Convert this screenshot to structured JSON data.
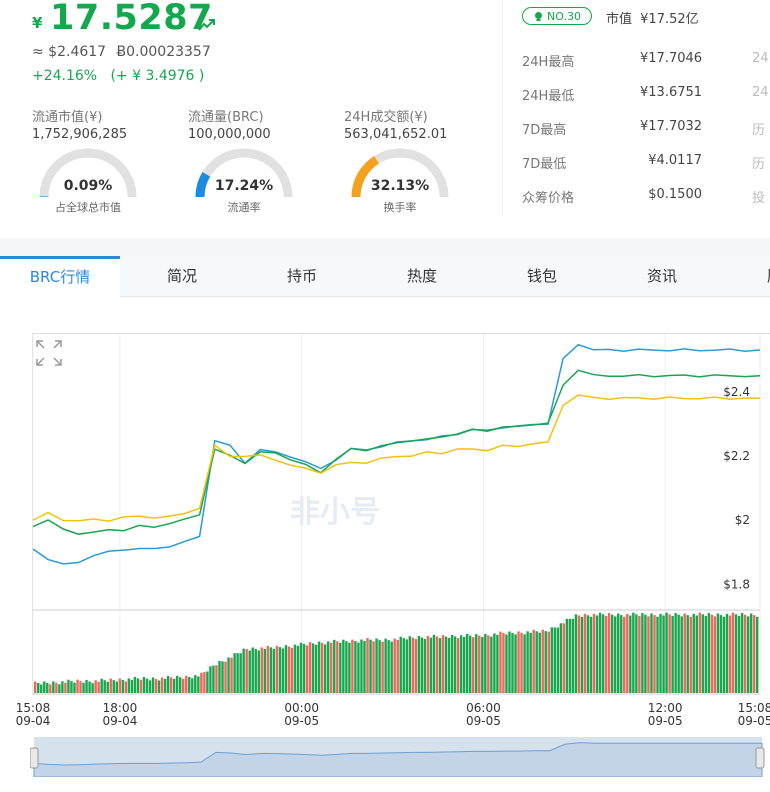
{
  "price": {
    "currency_symbol": "¥",
    "value": "17.5287",
    "usd": "≈ $2.4617",
    "btc": "Ƀ0.00023357",
    "change": "+24.16%   (+ ¥ 3.4976 )",
    "trend_icon": "trend-up-icon"
  },
  "stats": [
    {
      "label": "流通市值(¥)",
      "value": "1,752,906,285"
    },
    {
      "label": "流通量(BRC)",
      "value": "100,000,000"
    },
    {
      "label": "24H成交额(¥)",
      "value": "563,041,652.01"
    }
  ],
  "gauges": [
    {
      "percent_text": "0.09%",
      "percent": 0.09,
      "caption": "占全球总市值",
      "color": "#2a8ae0"
    },
    {
      "percent_text": "17.24%",
      "percent": 17.24,
      "caption": "流通率",
      "color": "#1f8be0"
    },
    {
      "percent_text": "32.13%",
      "percent": 32.13,
      "caption": "换手率",
      "color": "#f2a21d"
    }
  ],
  "rank": {
    "label": "NO.30"
  },
  "market_cap": {
    "label": "市值",
    "value": "¥17.52亿"
  },
  "right_stats": [
    {
      "label": "24H最高",
      "value": "¥17.7046",
      "cut": "24"
    },
    {
      "label": "24H最低",
      "value": "¥13.6751",
      "cut": "24"
    },
    {
      "label": "7D最高",
      "value": "¥17.7032",
      "cut": "历"
    },
    {
      "label": "7D最低",
      "value": "¥4.0117",
      "cut": "历"
    },
    {
      "label": "众筹价格",
      "value": "$0.1500",
      "cut": "投"
    }
  ],
  "tabs": [
    "BRC行情",
    "简况",
    "持币",
    "热度",
    "钱包",
    "资讯",
    "历史"
  ],
  "active_tab": 0,
  "watermark": "非小号",
  "expand_icon": "expand-arrows-icon",
  "chart_data": {
    "type": "line",
    "y_axis": {
      "ticks": [
        "$2.4",
        "$2.2",
        "$2",
        "$1.8"
      ],
      "range": [
        1.72,
        2.58
      ],
      "unit": "$"
    },
    "x_axis": {
      "ticks": [
        {
          "time": "15:08",
          "date": "09-04"
        },
        {
          "time": "18:00",
          "date": "09-04"
        },
        {
          "time": "00:00",
          "date": "09-05"
        },
        {
          "time": "06:00",
          "date": "09-05"
        },
        {
          "time": "12:00",
          "date": "09-05"
        },
        {
          "time": "15:08",
          "date": "09-05"
        }
      ]
    },
    "x_hours": [
      0,
      0.5,
      1,
      1.5,
      2,
      2.5,
      3,
      3.5,
      4,
      4.5,
      5,
      5.5,
      6,
      6.5,
      7,
      7.5,
      8,
      8.5,
      9,
      9.5,
      10,
      10.5,
      11,
      11.5,
      12,
      12.5,
      13,
      13.5,
      14,
      14.5,
      15,
      15.5,
      16,
      16.5,
      17,
      17.5,
      18,
      18.5,
      19,
      19.5,
      20,
      20.5,
      21,
      21.5,
      22,
      22.5,
      23,
      23.5,
      24
    ],
    "series": [
      {
        "color": "#2a9bd6",
        "values": [
          1.91,
          1.88,
          1.86,
          1.87,
          1.89,
          1.9,
          1.91,
          1.91,
          1.91,
          1.92,
          1.93,
          1.95,
          2.25,
          2.23,
          2.18,
          2.22,
          2.21,
          2.2,
          2.18,
          2.16,
          2.19,
          2.22,
          2.22,
          2.23,
          2.24,
          2.25,
          2.25,
          2.26,
          2.27,
          2.28,
          2.28,
          2.29,
          2.29,
          2.3,
          2.3,
          2.5,
          2.55,
          2.53,
          2.53,
          2.53,
          2.53,
          2.53,
          2.53,
          2.53,
          2.53,
          2.53,
          2.53,
          2.53,
          2.53
        ]
      },
      {
        "color": "#1aa64e",
        "values": [
          1.98,
          2.0,
          1.97,
          1.96,
          1.96,
          1.97,
          1.97,
          1.98,
          1.98,
          1.99,
          2.0,
          2.02,
          2.22,
          2.2,
          2.18,
          2.21,
          2.21,
          2.19,
          2.17,
          2.15,
          2.19,
          2.22,
          2.22,
          2.23,
          2.24,
          2.25,
          2.25,
          2.26,
          2.27,
          2.28,
          2.28,
          2.29,
          2.29,
          2.3,
          2.3,
          2.42,
          2.47,
          2.45,
          2.45,
          2.45,
          2.45,
          2.45,
          2.45,
          2.45,
          2.45,
          2.45,
          2.45,
          2.45,
          2.45
        ]
      },
      {
        "color": "#f2c20b",
        "values": [
          2.0,
          2.02,
          2.0,
          2.0,
          2.0,
          2.0,
          2.01,
          2.01,
          2.01,
          2.01,
          2.02,
          2.04,
          2.23,
          2.2,
          2.2,
          2.2,
          2.19,
          2.17,
          2.16,
          2.15,
          2.17,
          2.18,
          2.18,
          2.19,
          2.2,
          2.2,
          2.21,
          2.21,
          2.22,
          2.22,
          2.22,
          2.23,
          2.23,
          2.24,
          2.24,
          2.36,
          2.39,
          2.38,
          2.38,
          2.38,
          2.38,
          2.38,
          2.38,
          2.38,
          2.38,
          2.38,
          2.38,
          2.38,
          2.38
        ]
      }
    ],
    "volume_colors": {
      "up": "#1aa64e",
      "down": "#f0685a"
    },
    "volume_series": [
      0.14,
      0.15,
      0.16,
      0.17,
      0.17,
      0.18,
      0.19,
      0.2,
      0.2,
      0.21,
      0.22,
      0.24,
      0.38,
      0.46,
      0.56,
      0.57,
      0.58,
      0.6,
      0.62,
      0.64,
      0.65,
      0.66,
      0.67,
      0.67,
      0.68,
      0.7,
      0.71,
      0.71,
      0.72,
      0.72,
      0.73,
      0.75,
      0.76,
      0.77,
      0.78,
      0.87,
      0.97,
      0.98,
      0.98,
      0.98,
      0.98,
      0.98,
      0.98,
      0.98,
      0.98,
      0.98,
      0.98,
      0.98,
      0.98
    ]
  }
}
